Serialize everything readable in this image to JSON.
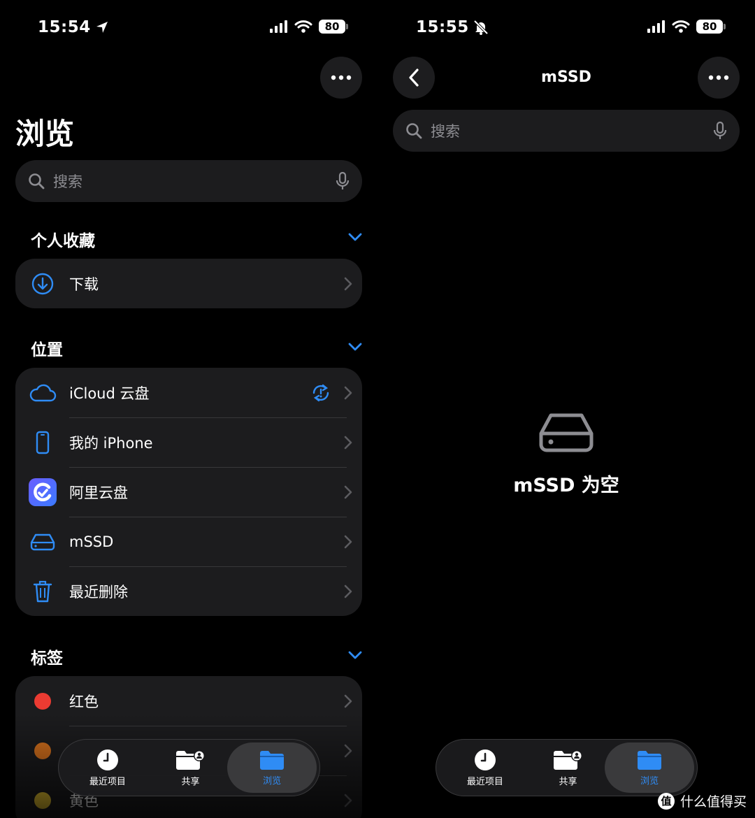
{
  "left": {
    "status": {
      "time": "15:54",
      "battery": "80"
    },
    "title": "浏览",
    "search": {
      "placeholder": "搜索"
    },
    "favorites": {
      "heading": "个人收藏",
      "items": [
        {
          "label": "下载",
          "icon": "download-circle-icon"
        }
      ]
    },
    "locations": {
      "heading": "位置",
      "items": [
        {
          "label": "iCloud 云盘",
          "icon": "cloud-icon",
          "badge_icon": "sync-alert-icon"
        },
        {
          "label": "我的 iPhone",
          "icon": "iphone-icon"
        },
        {
          "label": "阿里云盘",
          "icon": "aliyun-drive-app-icon"
        },
        {
          "label": "mSSD",
          "icon": "external-drive-icon"
        },
        {
          "label": "最近删除",
          "icon": "trash-icon"
        }
      ]
    },
    "tags": {
      "heading": "标签",
      "items": [
        {
          "label": "红色",
          "color": "#eb3b32"
        },
        {
          "label": "",
          "color": "#d8721d"
        },
        {
          "label": "黄色",
          "color": "#e9c531"
        }
      ]
    }
  },
  "right": {
    "status": {
      "time": "15:55",
      "battery": "80"
    },
    "nav_title": "mSSD",
    "search": {
      "placeholder": "搜索"
    },
    "empty_message": "mSSD 为空"
  },
  "tabbar": {
    "tabs": [
      {
        "label": "最近项目",
        "icon": "clock-icon"
      },
      {
        "label": "共享",
        "icon": "shared-folder-icon"
      },
      {
        "label": "浏览",
        "icon": "folder-icon",
        "active": true
      }
    ]
  },
  "watermark": {
    "text": "什么值得买",
    "logo": "值"
  },
  "colors": {
    "accent": "#2f8cf5",
    "background": "#000000",
    "card": "#1c1c1e"
  }
}
